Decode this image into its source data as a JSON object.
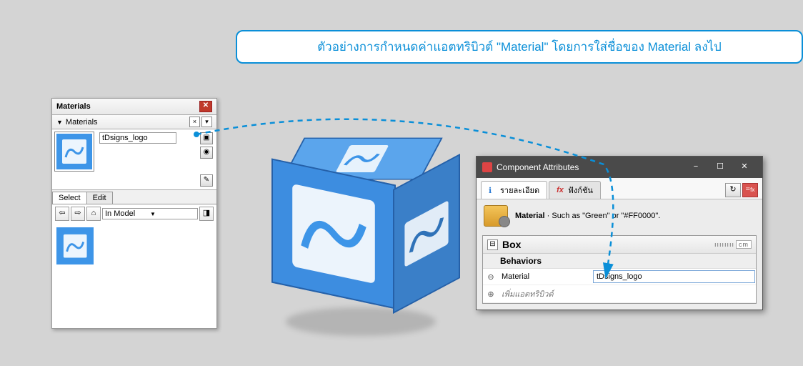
{
  "callout_text": "ตัวอย่างการกำหนดค่าแอตทริบิวต์ \"Material\" โดยการใส่ชื่อของ Material ลงไป",
  "materials_panel": {
    "title": "Materials",
    "sub_title": "Materials",
    "material_name": "tDsigns_logo",
    "tabs": {
      "select": "Select",
      "edit": "Edit"
    },
    "location_dd": "In Model"
  },
  "component_window": {
    "title": "Component Attributes",
    "tabs": {
      "details": "รายละเอียด",
      "functions": "ฟังก์ชัน"
    },
    "desc_label": "Material",
    "desc_text": " · Such as \"Green\" or \"#FF0000\".",
    "component_name": "Box",
    "unit": "cm",
    "section_behaviors": "Behaviors",
    "attr_material_label": "Material",
    "attr_material_value": "tDsigns_logo",
    "add_attr_label": "เพิ่มแอตทริบิวต์"
  },
  "icons": {
    "minus": "−",
    "maximize": "☐",
    "close": "✕",
    "tri_down": "▼",
    "back": "⇦",
    "fwd": "⇨",
    "home": "⌂",
    "info": "ℹ",
    "fx": "fx",
    "refresh": "↻",
    "eyedrop": "✎",
    "plus_c": "⊕",
    "minus_c": "⊖",
    "exp_m": "⊟"
  }
}
